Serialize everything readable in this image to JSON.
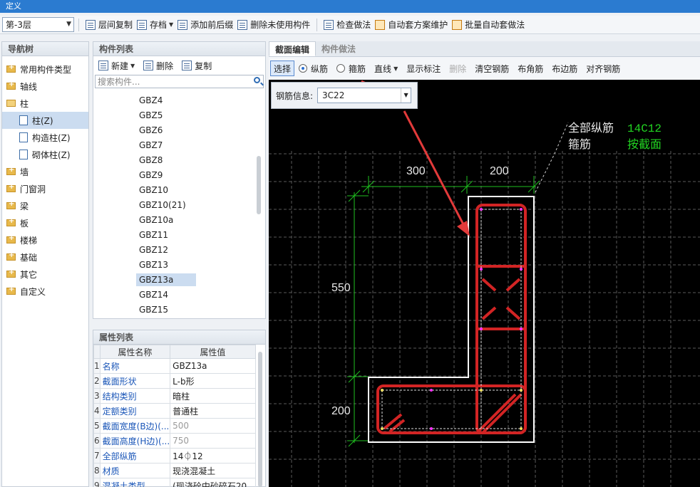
{
  "window": {
    "title": "定义"
  },
  "toolbar": {
    "floor": "第-3层",
    "buttons": [
      "层间复制",
      "存档",
      "添加前后缀",
      "删除未使用构件",
      "检查做法",
      "自动套方案维护",
      "批量自动套做法"
    ]
  },
  "nav": {
    "title": "导航树",
    "items": [
      "常用构件类型",
      "轴线",
      "柱",
      "柱(Z)",
      "构造柱(Z)",
      "砌体柱(Z)",
      "墙",
      "门窗洞",
      "梁",
      "板",
      "楼梯",
      "基础",
      "其它",
      "自定义"
    ]
  },
  "component_list": {
    "title": "构件列表",
    "new_label": "新建",
    "delete_label": "删除",
    "copy_label": "复制",
    "search_placeholder": "搜索构件...",
    "items": [
      "GBZ4",
      "GBZ5",
      "GBZ6",
      "GBZ7",
      "GBZ8",
      "GBZ9",
      "GBZ10",
      "GBZ10(21)",
      "GBZ10a",
      "GBZ11",
      "GBZ12",
      "GBZ13",
      "GBZ13a",
      "GBZ14",
      "GBZ15"
    ],
    "selected": "GBZ13a"
  },
  "property_list": {
    "title": "属性列表",
    "col_name": "属性名称",
    "col_value": "属性值",
    "rows": [
      {
        "num": "1",
        "name": "名称",
        "value": "GBZ13a"
      },
      {
        "num": "2",
        "name": "截面形状",
        "value": "L-b形"
      },
      {
        "num": "3",
        "name": "结构类别",
        "value": "暗柱"
      },
      {
        "num": "4",
        "name": "定额类别",
        "value": "普通柱"
      },
      {
        "num": "5",
        "name": "截面宽度(B边)(...",
        "value": "500"
      },
      {
        "num": "6",
        "name": "截面高度(H边)(...",
        "value": "750"
      },
      {
        "num": "7",
        "name": "全部纵筋",
        "value": "14⏀12"
      },
      {
        "num": "8",
        "name": "材质",
        "value": "现浇混凝土"
      },
      {
        "num": "9",
        "name": "混凝土类型",
        "value": "(现浇砼中砂碎石20..."
      }
    ]
  },
  "editor": {
    "tabs": [
      "截面编辑",
      "构件做法"
    ],
    "tools": [
      "选择",
      "纵筋",
      "箍筋",
      "直线",
      "显示标注",
      "删除",
      "清空钢筋",
      "布角筋",
      "布边筋",
      "对齐钢筋"
    ],
    "rebar_info_label": "钢筋信息:",
    "rebar_info_value": "3C22",
    "legend": {
      "long_bar_label": "全部纵筋",
      "long_bar_value": "14C12",
      "stirrup_label": "箍筋",
      "stirrup_value": "按截面"
    },
    "dims": {
      "top_left": "300",
      "top_right": "200",
      "left_upper": "550",
      "left_lower": "200"
    }
  },
  "colors": {
    "titlebar": "#2b7bd0",
    "canvas_bg": "#000000",
    "dim_line": "#1fbf1f",
    "rebar": "#d22424",
    "arrow": "#e23a3a",
    "legend_value": "#22d422"
  }
}
